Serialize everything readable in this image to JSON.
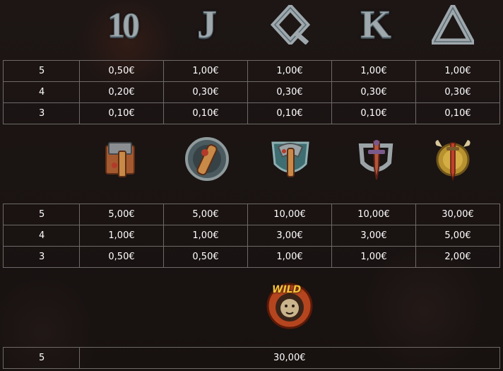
{
  "section1": {
    "symbols": [
      {
        "name": "10",
        "icon": "ten-letter"
      },
      {
        "name": "J",
        "icon": "j-letter"
      },
      {
        "name": "Q",
        "icon": "q-letter"
      },
      {
        "name": "K",
        "icon": "k-letter"
      },
      {
        "name": "A",
        "icon": "a-letter"
      }
    ],
    "rows": [
      {
        "count": "5",
        "values": [
          "0,50€",
          "1,00€",
          "1,00€",
          "1,00€",
          "1,00€"
        ]
      },
      {
        "count": "4",
        "values": [
          "0,20€",
          "0,30€",
          "0,30€",
          "0,30€",
          "0,30€"
        ]
      },
      {
        "count": "3",
        "values": [
          "0,10€",
          "0,10€",
          "0,10€",
          "0,10€",
          "0,10€"
        ]
      }
    ]
  },
  "section2": {
    "symbols": [
      {
        "icon": "hammer-icon"
      },
      {
        "icon": "club-shield-icon"
      },
      {
        "icon": "axe-shield-icon"
      },
      {
        "icon": "dagger-shield-icon"
      },
      {
        "icon": "sword-gold-shield-icon"
      }
    ],
    "rows": [
      {
        "count": "5",
        "values": [
          "5,00€",
          "5,00€",
          "10,00€",
          "10,00€",
          "30,00€"
        ]
      },
      {
        "count": "4",
        "values": [
          "1,00€",
          "1,00€",
          "3,00€",
          "3,00€",
          "5,00€"
        ]
      },
      {
        "count": "3",
        "values": [
          "0,50€",
          "0,50€",
          "1,00€",
          "1,00€",
          "2,00€"
        ]
      }
    ]
  },
  "section3": {
    "wild_label": "WILD",
    "rows": [
      {
        "count": "5",
        "value": "30,00€"
      }
    ]
  }
}
